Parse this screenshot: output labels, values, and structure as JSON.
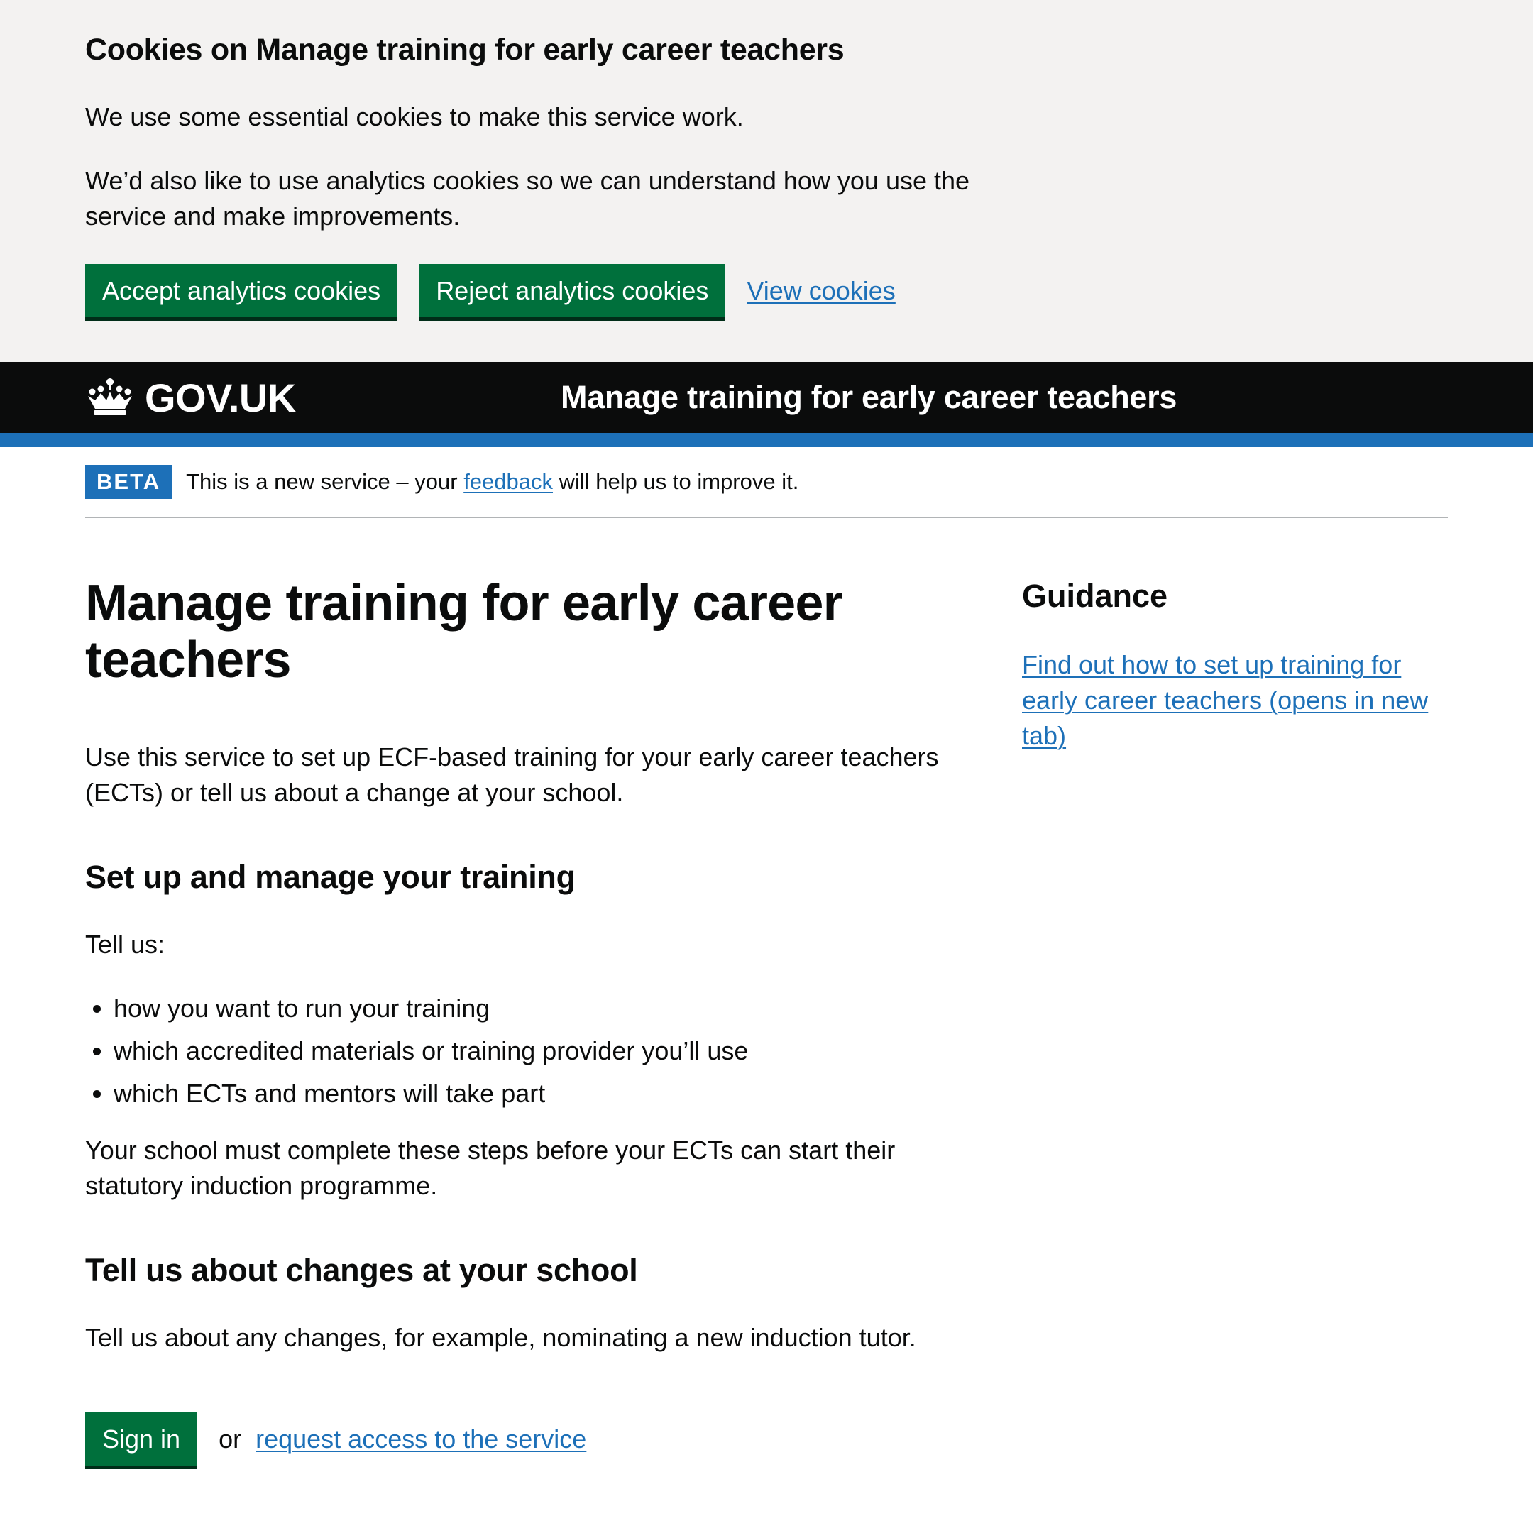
{
  "cookie_banner": {
    "title": "Cookies on Manage training for early career teachers",
    "paragraph_1": "We use some essential cookies to make this service work.",
    "paragraph_2": "We’d also like to use analytics cookies so we can understand how you use the service and make improvements.",
    "accept_label": "Accept analytics cookies",
    "reject_label": "Reject analytics cookies",
    "view_label": "View cookies"
  },
  "header": {
    "logo_text": "GOV.UK",
    "service_name": "Manage training for early career teachers"
  },
  "phase_banner": {
    "tag": "BETA",
    "text_before": "This is a new service – your ",
    "link": "feedback",
    "text_after": " will help us to improve it."
  },
  "main": {
    "title": "Manage training for early career teachers",
    "lead": "Use this service to set up ECF-based training for your early career teachers (ECTs) or tell us about a change at your school.",
    "section_1": {
      "heading": "Set up and manage your training",
      "intro": "Tell us:",
      "items": [
        "how you want to run your training",
        "which accredited materials or training provider you’ll use",
        "which ECTs and mentors will take part"
      ],
      "note": "Your school must complete these steps before your ECTs can start their statutory induction programme."
    },
    "section_2": {
      "heading": "Tell us about changes at your school",
      "text": "Tell us about any changes, for example, nominating a new induction tutor."
    },
    "sign_in_label": "Sign in",
    "or_text": "or",
    "request_access_label": "request access to the service"
  },
  "sidebar": {
    "title": "Guidance",
    "link": "Find out how to set up training for early career teachers (opens in new tab)"
  },
  "colors": {
    "button_green": "#00703c",
    "link_blue": "#1d70b8",
    "header_black": "#0b0c0c",
    "banner_grey": "#f3f2f1"
  }
}
